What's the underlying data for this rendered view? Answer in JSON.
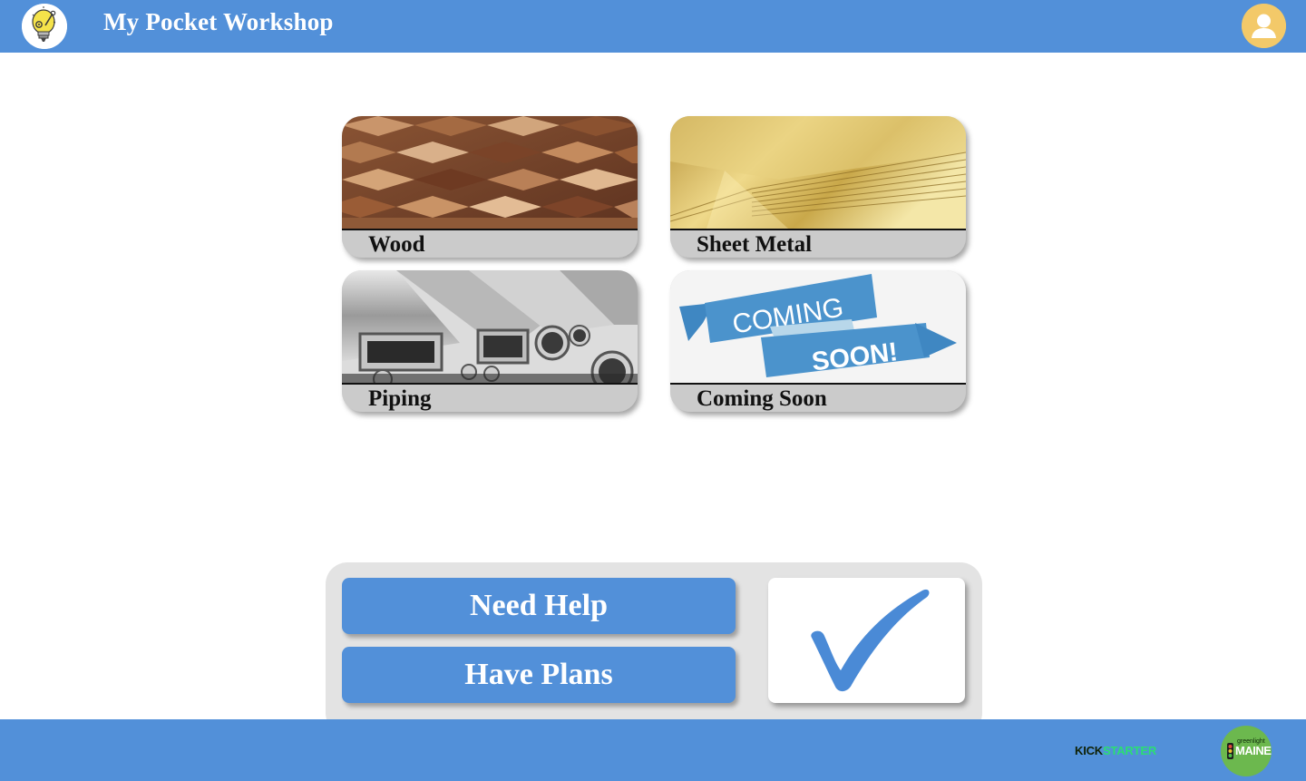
{
  "app": {
    "title": "My Pocket Workshop"
  },
  "materials": [
    {
      "label": "Wood"
    },
    {
      "label": "Sheet Metal"
    },
    {
      "label": "Piping"
    },
    {
      "label": "Coming Soon"
    }
  ],
  "coming_soon_banner": {
    "line1": "COMING",
    "line2": "SOON!"
  },
  "actions": {
    "need_help": "Need Help",
    "have_plans": "Have Plans"
  },
  "footer": {
    "kickstarter_part1": "KICK",
    "kickstarter_part2": "STARTER",
    "greenlight_small": "greenlight",
    "greenlight_big": "MAINE"
  },
  "colors": {
    "primary": "#5290d9",
    "panel": "#e3e3e3",
    "card_bar": "#cbcbcb",
    "avatar": "#f3c969"
  }
}
